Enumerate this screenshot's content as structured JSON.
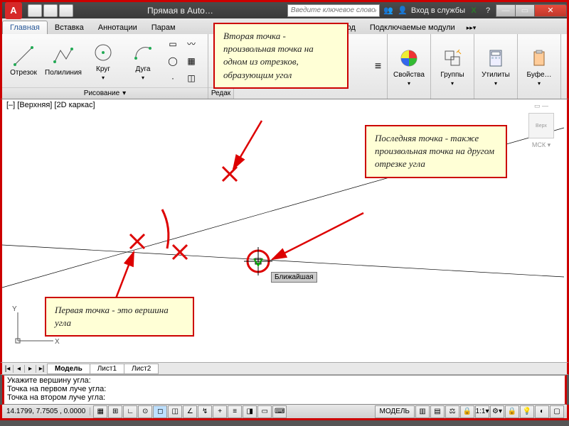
{
  "titlebar": {
    "app_letter": "A",
    "title": "Прямая в Auto… ",
    "search_placeholder": "Введите ключевое слово/фразу",
    "signin": "Вход в службы"
  },
  "tabs": [
    "Главная",
    "Вставка",
    "Аннотации",
    "Парам",
    "",
    "Вывод",
    "Подключаемые модули"
  ],
  "active_tab": 0,
  "ribbon": {
    "draw": {
      "line": "Отрезок",
      "pline": "Полилиния",
      "circle": "Круг",
      "arc": "Дуга",
      "title": "Рисование"
    },
    "edit_label": "Редак",
    "props": "Свойства",
    "groups": "Группы",
    "utils": "Утилиты",
    "buf": "Буфе…"
  },
  "view_label": "[–] [Верхняя] [2D каркас]",
  "nav": {
    "cube": "Верх",
    "wcs": "МСК"
  },
  "tooltip": "Ближайшая",
  "notes": {
    "first": "Первая точка - это вершина угла",
    "second": "Вторая точка - произвольная точка на одном из отрезков, образующим угол",
    "last": "Последняя точка - также произвольная точка на другом отрезке угла"
  },
  "sheet_tabs": [
    "Модель",
    "Лист1",
    "Лист2"
  ],
  "cmd_lines": [
    "Укажите вершину угла:",
    "Точка на первом луче угла:",
    "Точка на втором луче угла:"
  ],
  "status": {
    "coords": "14.1799, 7.7505 , 0.0000",
    "model": "МОДЕЛЬ"
  }
}
